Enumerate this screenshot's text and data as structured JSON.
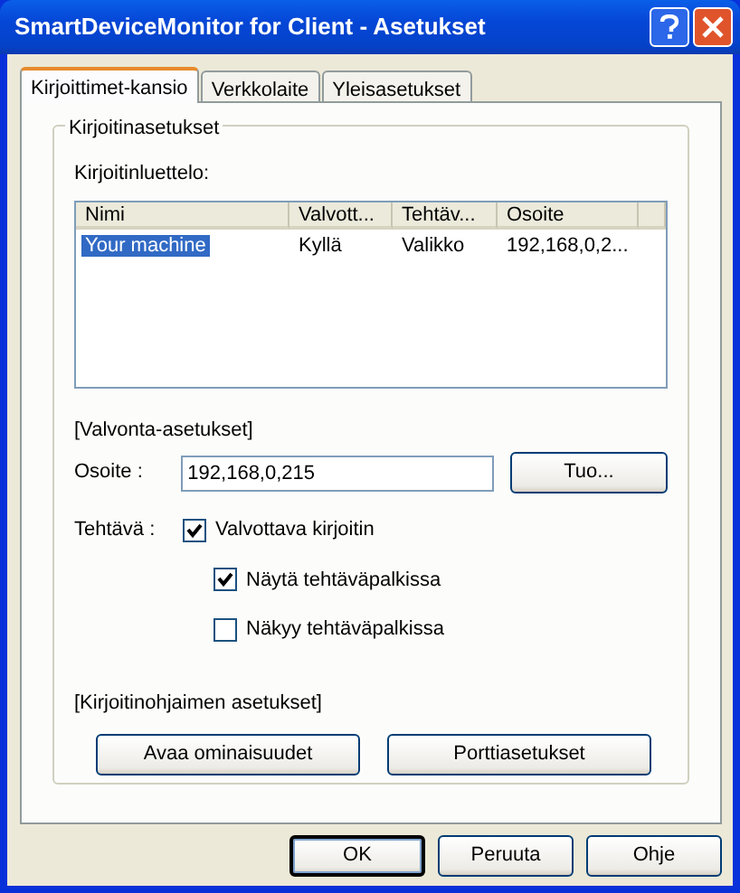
{
  "window": {
    "title": "SmartDeviceMonitor for Client - Asetukset"
  },
  "tabs": [
    {
      "label": "Kirjoittimet-kansio",
      "selected": true
    },
    {
      "label": "Verkkolaite",
      "selected": false
    },
    {
      "label": "Yleisasetukset",
      "selected": false
    }
  ],
  "group": {
    "title": "Kirjoitinasetukset",
    "list_label": "Kirjoitinluettelo:",
    "columns": [
      "Nimi",
      "Valvott...",
      "Tehtäv...",
      "Osoite"
    ],
    "rows": [
      {
        "cells": [
          "Your machine",
          "Kyllä",
          "Valikko",
          "192,168,0,2..."
        ],
        "selected": true
      }
    ],
    "monitoring": {
      "heading": "[Valvonta-asetukset]",
      "address_label": "Osoite :",
      "address_value": "192,168,0,215",
      "import_button": "Tuo...",
      "task_label": "Tehtävä :",
      "checkboxes": [
        {
          "label": "Valvottava kirjoitin",
          "checked": true,
          "children": [
            {
              "label": "Näytä tehtäväpalkissa",
              "checked": true
            },
            {
              "label": "Näkyy tehtäväpalkissa",
              "checked": false
            }
          ]
        }
      ]
    },
    "driver": {
      "heading": "[Kirjoitinohjaimen asetukset]",
      "buttons": [
        "Avaa ominaisuudet",
        "Porttiasetukset"
      ]
    }
  },
  "footer_buttons": [
    {
      "label": "OK",
      "default": true
    },
    {
      "label": "Peruuta",
      "default": false
    },
    {
      "label": "Ohje",
      "default": false
    }
  ]
}
